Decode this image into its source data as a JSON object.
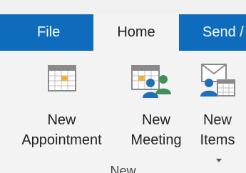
{
  "tabs": {
    "file": "File",
    "home": "Home",
    "send": "Send /"
  },
  "commands": {
    "new_appointment": {
      "line1": "New",
      "line2": "Appointment",
      "icon": "calendar-icon"
    },
    "new_meeting": {
      "line1": "New",
      "line2": "Meeting",
      "icon": "meeting-calendar-icon"
    },
    "new_items": {
      "line1": "New",
      "line2": "Items",
      "icon": "new-items-icon"
    }
  },
  "group": {
    "label": "New"
  },
  "colors": {
    "ribbon_blue": "#0f6cbd",
    "ribbon_bg": "#f3f3f3",
    "calendar_accent": "#f0b040"
  }
}
